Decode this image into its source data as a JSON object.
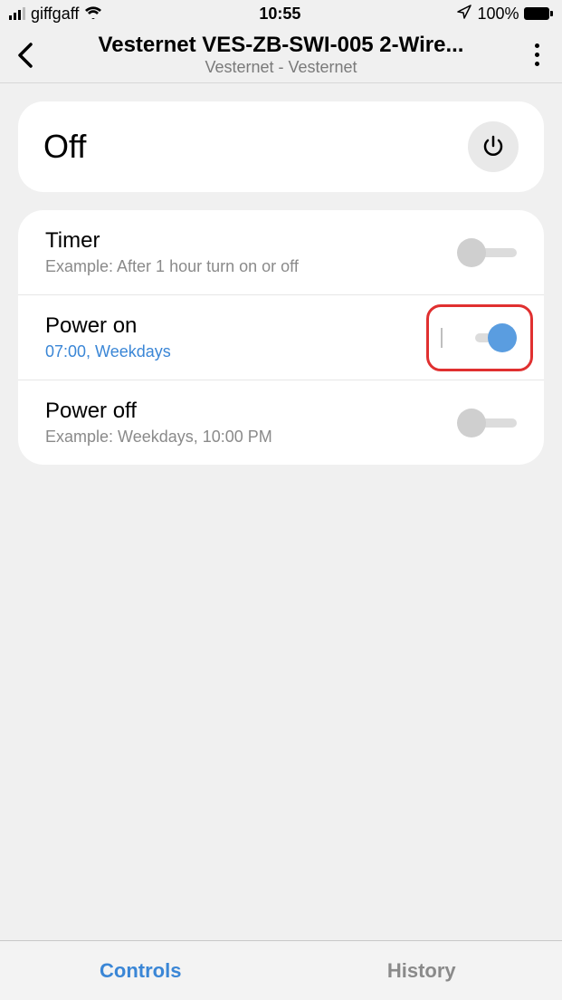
{
  "status": {
    "carrier": "giffgaff",
    "time": "10:55",
    "battery_pct": "100%"
  },
  "header": {
    "title": "Vesternet VES-ZB-SWI-005 2-Wire...",
    "subtitle": "Vesternet - Vesternet"
  },
  "state": {
    "label": "Off"
  },
  "rows": {
    "timer": {
      "title": "Timer",
      "sub": "Example: After 1 hour turn on or off",
      "on": false
    },
    "power_on": {
      "title": "Power on",
      "sub": "07:00, Weekdays",
      "on": true,
      "highlighted": true
    },
    "power_off": {
      "title": "Power off",
      "sub": "Example: Weekdays, 10:00 PM",
      "on": false
    }
  },
  "tabs": {
    "controls": "Controls",
    "history": "History",
    "active": "controls"
  },
  "colors": {
    "accent": "#3a86d6",
    "highlight_border": "#e03030"
  }
}
